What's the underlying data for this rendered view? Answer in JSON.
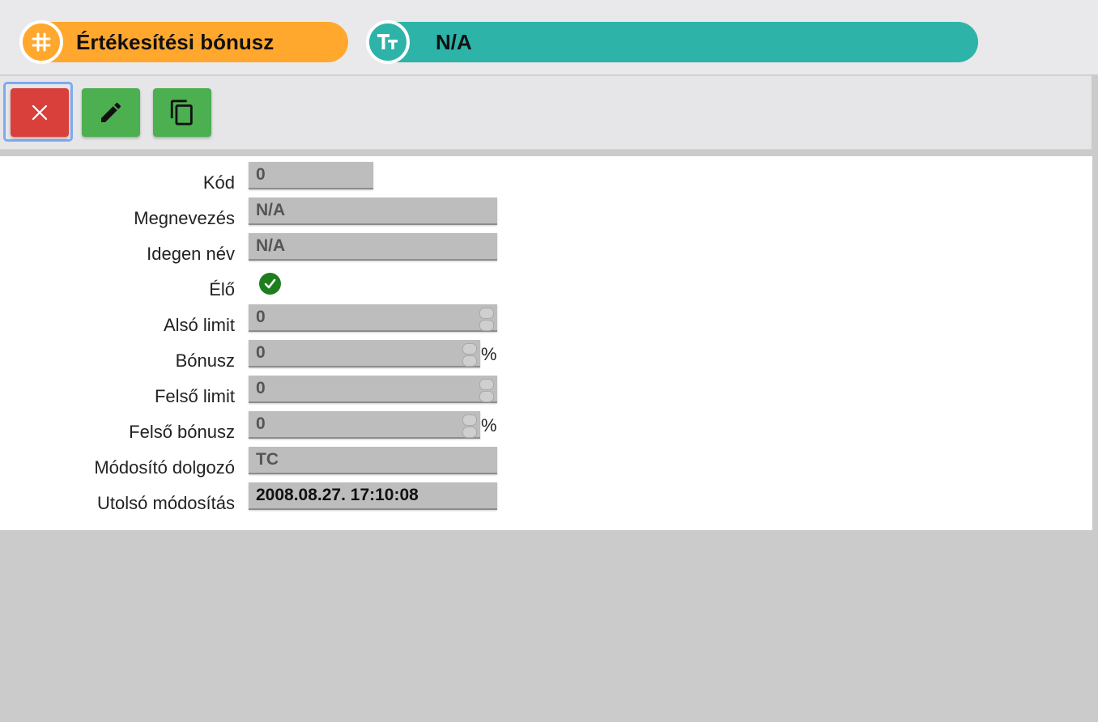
{
  "header": {
    "left_pill": {
      "icon": "hash-icon",
      "title": "Értékesítési bónusz",
      "color": "#ffa82d"
    },
    "right_pill": {
      "icon": "text-type-icon",
      "title": "N/A",
      "color": "#2db3a8"
    }
  },
  "toolbar": {
    "buttons": [
      {
        "name": "close",
        "icon": "close-icon",
        "color": "#d9403b"
      },
      {
        "name": "edit",
        "icon": "pencil-icon",
        "color": "#4caf50"
      },
      {
        "name": "copy",
        "icon": "copy-icon",
        "color": "#4caf50"
      }
    ]
  },
  "form": {
    "kod": {
      "label": "Kód",
      "value": "0"
    },
    "megnevezes": {
      "label": "Megnevezés",
      "value": "N/A"
    },
    "idegen_nev": {
      "label": "Idegen név",
      "value": "N/A"
    },
    "elo": {
      "label": "Élő",
      "checked": true
    },
    "also_limit": {
      "label": "Alsó limit",
      "value": "0"
    },
    "bonusz": {
      "label": "Bónusz",
      "value": "0",
      "unit": "%"
    },
    "felso_limit": {
      "label": "Felső limit",
      "value": "0"
    },
    "felso_bonusz": {
      "label": "Felső bónusz",
      "value": "0",
      "unit": "%"
    },
    "modosito_dolgozo": {
      "label": "Módosító dolgozó",
      "value": "TC"
    },
    "utolso_modositas": {
      "label": "Utolsó módosítás",
      "value": "2008.08.27. 17:10:08"
    }
  }
}
